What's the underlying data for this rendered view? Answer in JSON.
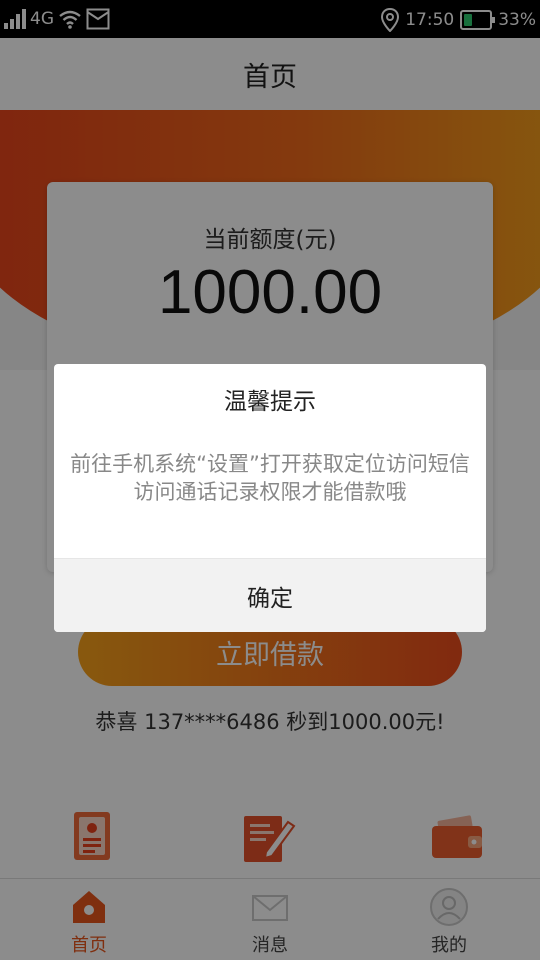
{
  "status_bar": {
    "network": "4G",
    "time": "17:50",
    "battery": "33%",
    "battery_level": 0.33,
    "battery_color": "#2ecc71",
    "icons": [
      "signal-icon",
      "wifi-icon",
      "message-icon",
      "location-icon",
      "battery-icon"
    ]
  },
  "header": {
    "title": "首页"
  },
  "colors": {
    "accent": "#e8561d",
    "button_start": "#f7a21b",
    "button_end": "#ec4c1c"
  },
  "card": {
    "label": "当前额度(元)",
    "amount": "1000.00"
  },
  "borrow_button": {
    "label": "立即借款"
  },
  "congrats": "恭喜 137****6486 秒到1000.00元!",
  "features": [
    {
      "icon": "id-card-icon"
    },
    {
      "icon": "edit-document-icon"
    },
    {
      "icon": "wallet-icon"
    }
  ],
  "tabs": [
    {
      "label": "首页",
      "icon": "home-icon",
      "active": true
    },
    {
      "label": "消息",
      "icon": "mail-icon",
      "active": false
    },
    {
      "label": "我的",
      "icon": "user-icon",
      "active": false
    }
  ],
  "dialog": {
    "title": "温馨提示",
    "message": "前往手机系统“设置”打开获取定位访问短信访问通话记录权限才能借款哦",
    "ok_label": "确定"
  }
}
